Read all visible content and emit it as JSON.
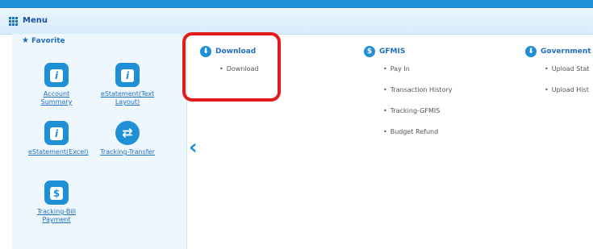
{
  "header": {
    "title": "Menu"
  },
  "favorite": {
    "title": "Favorite",
    "tiles": [
      {
        "label": "Account Summary",
        "icon": "info-icon"
      },
      {
        "label": "eStatement(Text Layout)",
        "icon": "info-icon"
      },
      {
        "label": "eStatement(Excel)",
        "icon": "info-icon"
      },
      {
        "label": "Tracking-Transfer",
        "icon": "transfer-icon"
      },
      {
        "label": "Tracking-Bill Payment",
        "icon": "dollar-icon"
      }
    ]
  },
  "columns": [
    {
      "title": "Download",
      "icon": "download-icon",
      "items": [
        "Download"
      ]
    },
    {
      "title": "GFMIS",
      "icon": "dollar-icon",
      "items": [
        "Pay In",
        "Transaction History",
        "Tracking-GFMIS",
        "Budget Refund"
      ]
    },
    {
      "title": "Government",
      "icon": "download-icon",
      "items": [
        "Upload Stat",
        "Upload Hist"
      ]
    }
  ],
  "nav": {
    "prev_icon": "chevron-left-icon"
  },
  "colors": {
    "accent": "#1f8fd6",
    "highlight": "#e31b1b"
  }
}
